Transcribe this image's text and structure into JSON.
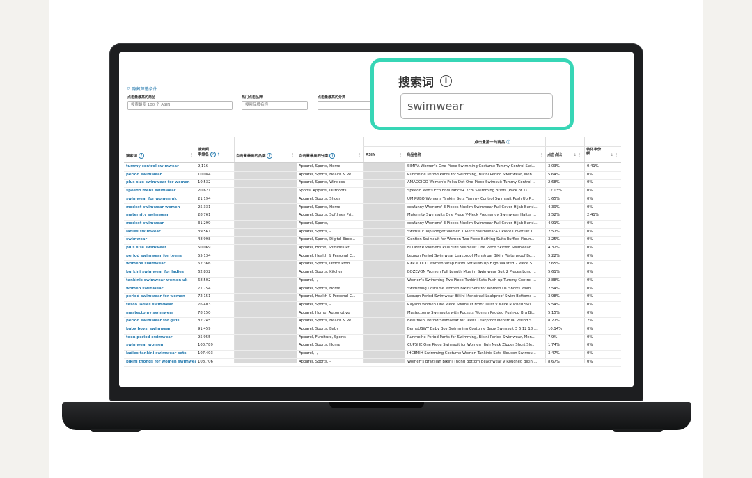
{
  "filters": {
    "toggle_label": "隐藏筛选条件",
    "products_label": "点击量最高的商品",
    "products_placeholder": "搜索最多 100 个 ASIN",
    "brands_label": "热门点击品牌",
    "brands_placeholder": "搜索品牌名称",
    "categories_label": "点击量最高的分类"
  },
  "callout": {
    "title": "搜索词",
    "input_value": "swimwear"
  },
  "table": {
    "group_header": "点击量第一的商品",
    "headers": {
      "term": "搜索词",
      "rank_line1": "搜索频",
      "rank_line2": "率排名",
      "brand": "点击量最高的品牌",
      "category": "点击量最高的分类",
      "asin": "ASIN",
      "product": "商品名称",
      "share": "点击占比",
      "conv_line1": "转化率份",
      "conv_line2": "额"
    },
    "rows": [
      {
        "term": "tummy control swimwear",
        "rank": "9,116",
        "category": "Apparel, Sports, Home",
        "product": "SIMIYA Women's One Piece Swimming Costume Tummy Control Swi...",
        "share": "3.03%",
        "conv": "0.41%"
      },
      {
        "term": "period swimwear",
        "rank": "10,084",
        "category": "Apparel, Sports, Health & Pe...",
        "product": "Runmelhe Period Pants for Swimming, Bikini Period Swimwear, Men...",
        "share": "5.64%",
        "conv": "0%"
      },
      {
        "term": "plus size swimwear for women",
        "rank": "10,532",
        "category": "Apparel, Sports, Wireless",
        "product": "AMAGGIGO Women's Polka Dot One Piece Swimsuit Tummy Control ...",
        "share": "2.68%",
        "conv": "0%"
      },
      {
        "term": "speedo mens swimwear",
        "rank": "20,621",
        "category": "Sports, Apparel, Outdoors",
        "product": "Speedo Men's Eco Endurance+ 7cm Swimming Briefs (Pack of 1)",
        "share": "12.03%",
        "conv": "0%"
      },
      {
        "term": "swimwear for women uk",
        "rank": "21,194",
        "category": "Apparel, Sports, Shoes",
        "product": "UMIPUBO Womens Tankini Sets Tummy Control Swimsuit Push Up P...",
        "share": "1.65%",
        "conv": "0%"
      },
      {
        "term": "modest swimwear women",
        "rank": "25,331",
        "category": "Apparel, Sports, Home",
        "product": "seafanny Womens' 3 Pieces Muslim Swimwear Full Cover Hijab Burki...",
        "share": "4.39%",
        "conv": "0%"
      },
      {
        "term": "maternity swimwear",
        "rank": "28,761",
        "category": "Apparel, Sports, Softlines Pri...",
        "product": "Maternity Swimsuits One Piece V-Neck Pregnancy Swimwear Halter ...",
        "share": "3.52%",
        "conv": "2.41%"
      },
      {
        "term": "modest swimwear",
        "rank": "31,299",
        "category": "Apparel, Sports, -",
        "product": "seafanny Womens' 3 Pieces Muslim Swimwear Full Cover Hijab Burki...",
        "share": "4.91%",
        "conv": "0%"
      },
      {
        "term": "ladies swimwear",
        "rank": "39,561",
        "category": "Apparel, Sports, -",
        "product": "Swimsuit Top Longer Women 1 Piece Swimwear+1 Piece Cover UP T...",
        "share": "2.57%",
        "conv": "0%"
      },
      {
        "term": "swimwear",
        "rank": "48,998",
        "category": "Apparel, Sports, Digital Eboo...",
        "product": "Genfien Swimsuit for Women Two Piece Bathing Suits Ruffled Floun...",
        "share": "3.25%",
        "conv": "0%"
      },
      {
        "term": "plus size swimwear",
        "rank": "50,069",
        "category": "Apparel, Home, Softlines Pri...",
        "product": "ECUPPER Womens Plus Size Swimsuit One Piece Skirted Swimwear ...",
        "share": "4.32%",
        "conv": "0%"
      },
      {
        "term": "period swimwear for teens",
        "rank": "55,134",
        "category": "Apparel, Health & Personal C...",
        "product": "Leovqn Period Swimwear Leakproof Menstrual Bikini Waterproof Bo...",
        "share": "5.22%",
        "conv": "0%"
      },
      {
        "term": "womens swimwear",
        "rank": "62,366",
        "category": "Apparel, Sports, Office Prod...",
        "product": "RXRXCOCO Women Wrap Bikini Set Push Up High Waisted 2 Piece S...",
        "share": "2.65%",
        "conv": "0%"
      },
      {
        "term": "burkini swimwear for ladies",
        "rank": "62,832",
        "category": "Apparel, Sports, Kitchen",
        "product": "BOZEVON Women Full Length Muslim Swimwear Suit 2 Pieces Long ...",
        "share": "5.61%",
        "conv": "0%"
      },
      {
        "term": "tankinis swimwear women uk",
        "rank": "68,502",
        "category": "Apparel, -, -",
        "product": "Women's Swimming Two Piece Tankini Sets Push up Tummy Control ...",
        "share": "2.88%",
        "conv": "0%"
      },
      {
        "term": "women swimwear",
        "rank": "71,754",
        "category": "Apparel, Sports, Home",
        "product": "Swimming Costume Women Bikini Sets for Women UK Shorts Wom...",
        "share": "2.54%",
        "conv": "0%"
      },
      {
        "term": "period swimwear for women",
        "rank": "72,151",
        "category": "Apparel, Health & Personal C...",
        "product": "Leovqn Period Swimwear Bikini Menstrual Leakproof Swim Bottoms ...",
        "share": "3.98%",
        "conv": "0%"
      },
      {
        "term": "tesco ladies swimwear",
        "rank": "76,403",
        "category": "Apparel, Sports, -",
        "product": "Rayson Women One Piece Swimsuit Front Twist V Neck Ruched Swi...",
        "share": "5.54%",
        "conv": "0%"
      },
      {
        "term": "mastectomy swimwear",
        "rank": "78,150",
        "category": "Apparel, Home, Automotive",
        "product": "Mastectomy Swimsuits with Pockets Women Padded Push-up Bra Bi...",
        "share": "5.15%",
        "conv": "0%"
      },
      {
        "term": "period swimwear for girls",
        "rank": "82,245",
        "category": "Apparel, Sports, Health & Pe...",
        "product": "Beautikini Period Swimwear for Teens Leakproof Menstrual Period S...",
        "share": "8.27%",
        "conv": "2%"
      },
      {
        "term": "baby boys' swimwear",
        "rank": "91,459",
        "category": "Apparel, Sports, Baby",
        "product": "BemeUSWT Baby Boy Swimming Costume Baby Swimsuit 3 6 12 18 ...",
        "share": "10.14%",
        "conv": "0%"
      },
      {
        "term": "teen period swimwear",
        "rank": "95,955",
        "category": "Apparel, Furniture, Sports",
        "product": "Runmelhe Period Pants for Swimming, Bikini Period Swimwear, Men...",
        "share": "7.9%",
        "conv": "0%"
      },
      {
        "term": "swimwear women",
        "rank": "100,789",
        "category": "Apparel, Sports, Home",
        "product": "CUPSHE One Piece Swimsuit for Women High Neck Zipper Short Sle...",
        "share": "1.74%",
        "conv": "0%"
      },
      {
        "term": "ladies tankini swimwear sets",
        "rank": "107,403",
        "category": "Apparel, -, -",
        "product": "IHCEMIH Swimming Costume Women Tankinis Sets Blouson Swimsu...",
        "share": "3.47%",
        "conv": "0%"
      },
      {
        "term": "bikini thongs for women swimwear",
        "rank": "108,706",
        "category": "Apparel, Sports, -",
        "product": "Women's Brazilian Bikini Thong Bottom Beachwear V Rouched Bikini...",
        "share": "8.67%",
        "conv": "0%"
      }
    ]
  }
}
